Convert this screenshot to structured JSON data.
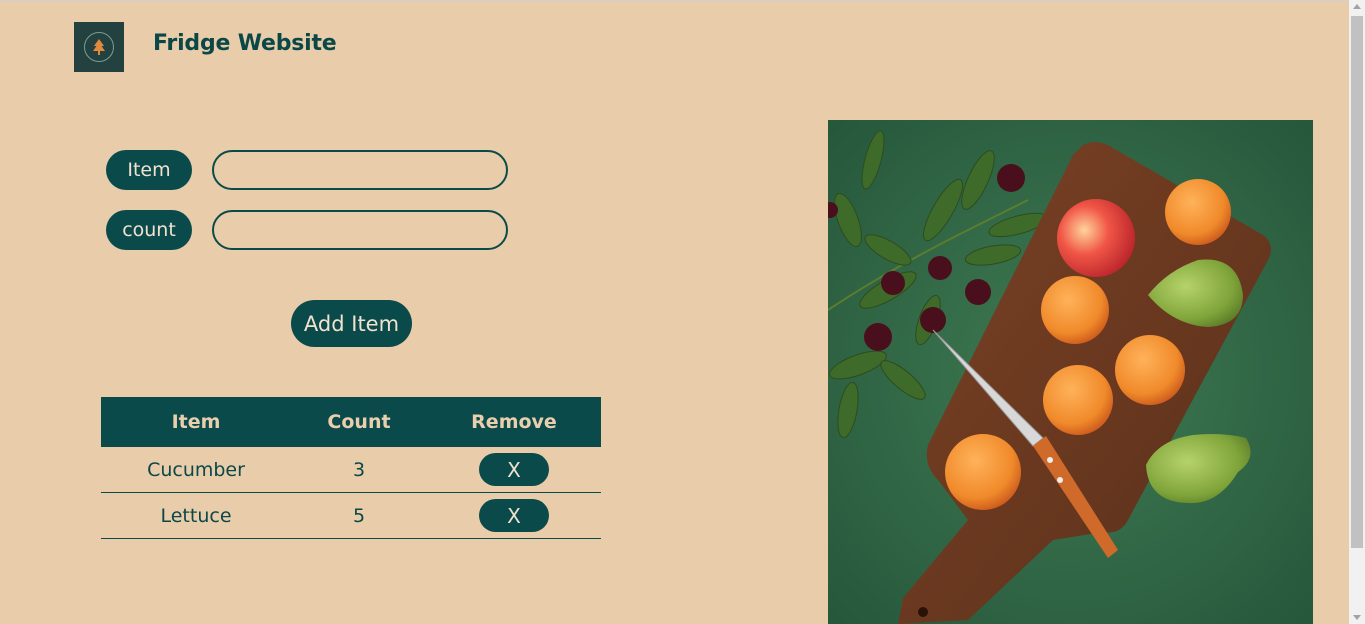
{
  "header": {
    "logo_icon": "tree-icon",
    "title": "Fridge Website"
  },
  "form": {
    "item_label": "Item",
    "item_value": "",
    "count_label": "count",
    "count_value": "",
    "add_button": "Add Item"
  },
  "table": {
    "headers": [
      "Item",
      "Count",
      "Remove"
    ],
    "rows": [
      {
        "item": "Cucumber",
        "count": "3",
        "remove": "X"
      },
      {
        "item": "Lettuce",
        "count": "5",
        "remove": "X"
      }
    ]
  },
  "image": {
    "subject": "fruits-on-cutting-board"
  },
  "colors": {
    "background": "#e9cdaa",
    "primary": "#0b4a4a",
    "on_primary": "#f0e2cf"
  }
}
